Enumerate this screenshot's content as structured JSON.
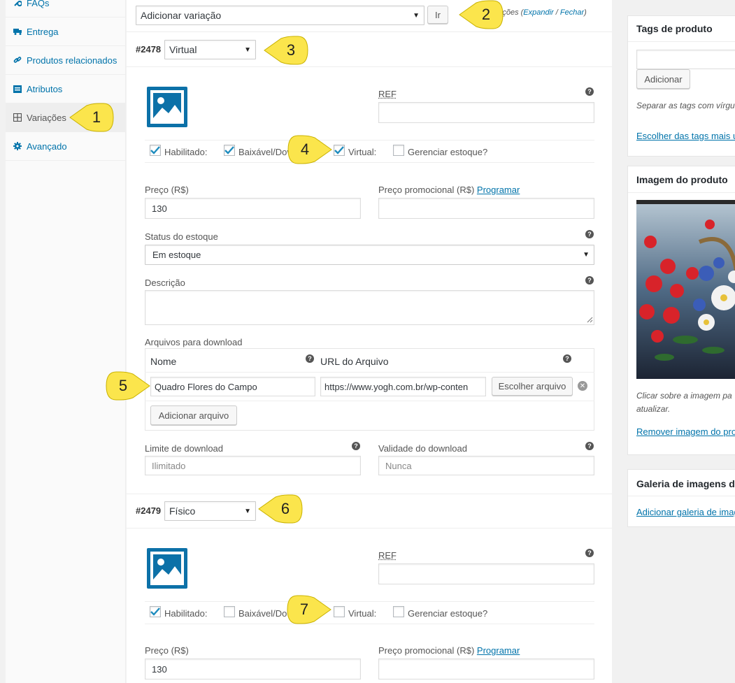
{
  "tabs": [
    {
      "label": "FAQs",
      "icon": "wrench-icon"
    },
    {
      "label": "Entrega",
      "icon": "truck-icon"
    },
    {
      "label": "Produtos relacionados",
      "icon": "link-icon"
    },
    {
      "label": "Atributos",
      "icon": "list-icon"
    },
    {
      "label": "Variações",
      "icon": "grid-icon"
    },
    {
      "label": "Avançado",
      "icon": "gear-icon"
    }
  ],
  "toolbar": {
    "add_variation": "Adicionar variação",
    "go_button": "Ir",
    "variations_text": "ariações (",
    "expand": "Expandir",
    "slash": " / ",
    "close": "Fechar",
    "close_paren": ")"
  },
  "variation1": {
    "id": "#2478",
    "type": "Virtual",
    "ref_label": "REF",
    "ref_value": "",
    "enabled_label": "Habilitado:",
    "enabled": true,
    "downloadable_label": "Baixável/Dov",
    "downloadable": true,
    "virtual_label": "Virtual:",
    "virtual": true,
    "manage_stock_label": "Gerenciar estoque?",
    "manage_stock": false,
    "price_label": "Preço (R$)",
    "price": "130",
    "sale_price_label": "Preço promocional (R$)",
    "schedule_link": "Programar",
    "sale_price": "",
    "stock_status_label": "Status do estoque",
    "stock_status": "Em estoque",
    "description_label": "Descrição",
    "description": "",
    "downloads_label": "Arquivos para download",
    "col_name": "Nome",
    "col_url": "URL do Arquivo",
    "file_name": "Quadro Flores do Campo",
    "file_url": "https://www.yogh.com.br/wp-conten",
    "choose_file": "Escolher arquivo",
    "add_file": "Adicionar arquivo",
    "download_limit_label": "Limite de download",
    "download_limit_placeholder": "Ilimitado",
    "download_expiry_label": "Validade do download",
    "download_expiry_placeholder": "Nunca"
  },
  "variation2": {
    "id": "#2479",
    "type": "Físico",
    "ref_label": "REF",
    "enabled_label": "Habilitado:",
    "enabled": true,
    "downloadable_label": "Baixável/Do",
    "downloadable": false,
    "virtual_label": "Virtual:",
    "virtual": false,
    "manage_stock_label": "Gerenciar estoque?",
    "manage_stock": false,
    "price_label": "Preço (R$)",
    "price": "130",
    "sale_price_label": "Preço promocional (R$)",
    "schedule_link": "Programar"
  },
  "sidebar": {
    "tags_title": "Tags de produto",
    "tags_add": "Adicionar",
    "tags_hint": "Separar as tags com vírgu",
    "tags_choose": "Escolher das tags mais u",
    "image_title": "Imagem do produto",
    "image_hint_1": "Clicar sobre a imagem pa",
    "image_hint_2": "atualizar.",
    "image_remove": "Remover imagem do pro",
    "gallery_title": "Galeria de imagens do",
    "gallery_add": "Adicionar galeria de imag"
  },
  "callouts": [
    "1",
    "2",
    "3",
    "4",
    "5",
    "6",
    "7"
  ],
  "colors": {
    "accent": "#0073aa",
    "callout": "#fbe54c",
    "image_icon": "#0c71a8"
  }
}
